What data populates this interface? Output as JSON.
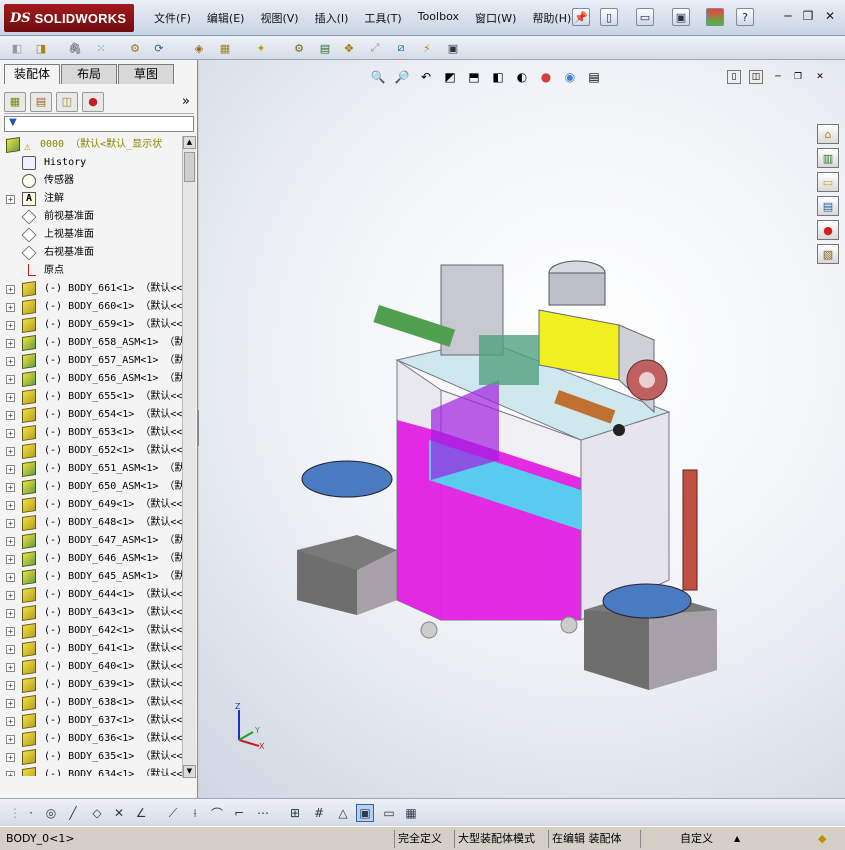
{
  "app": {
    "logo_ds": "DS",
    "logo_text": "SOLIDWORKS"
  },
  "menu": [
    "文件(F)",
    "编辑(E)",
    "视图(V)",
    "插入(I)",
    "工具(T)",
    "Toolbox",
    "窗口(W)",
    "帮助(H)"
  ],
  "left_panel": {
    "tabs": [
      "装配体",
      "布局",
      "草图"
    ],
    "active_tab": 0,
    "expand_label": "»",
    "filter_label": "▼"
  },
  "tree": {
    "root": "0000 （默认<默认_显示状",
    "system_items": [
      {
        "label": "History",
        "icon": "history-icon",
        "type": "hist"
      },
      {
        "label": "传感器",
        "icon": "sensor-icon",
        "type": "sensor"
      },
      {
        "label": "注解",
        "icon": "annotation-icon",
        "type": "note"
      },
      {
        "label": "前视基准面",
        "icon": "plane-icon",
        "type": "plane"
      },
      {
        "label": "上视基准面",
        "icon": "plane-icon",
        "type": "plane"
      },
      {
        "label": "右视基准面",
        "icon": "plane-icon",
        "type": "plane"
      },
      {
        "label": "原点",
        "icon": "origin-icon",
        "type": "origin"
      }
    ],
    "components": [
      {
        "label": "(-) BODY_661<1> （默认<<",
        "type": "part"
      },
      {
        "label": "(-) BODY_660<1> （默认<<",
        "type": "part"
      },
      {
        "label": "(-) BODY_659<1> （默认<<",
        "type": "part"
      },
      {
        "label": "(-) BODY_658_ASM<1> （默",
        "type": "asm"
      },
      {
        "label": "(-) BODY_657_ASM<1> （默",
        "type": "asm"
      },
      {
        "label": "(-) BODY_656_ASM<1> （默",
        "type": "asm"
      },
      {
        "label": "(-) BODY_655<1> （默认<<",
        "type": "part"
      },
      {
        "label": "(-) BODY_654<1> （默认<<",
        "type": "part"
      },
      {
        "label": "(-) BODY_653<1> （默认<<",
        "type": "part"
      },
      {
        "label": "(-) BODY_652<1> （默认<<",
        "type": "part"
      },
      {
        "label": "(-) BODY_651_ASM<1> （默",
        "type": "asm"
      },
      {
        "label": "(-) BODY_650_ASM<1> （默",
        "type": "asm"
      },
      {
        "label": "(-) BODY_649<1> （默认<<",
        "type": "part"
      },
      {
        "label": "(-) BODY_648<1> （默认<<",
        "type": "part"
      },
      {
        "label": "(-) BODY_647_ASM<1> （默",
        "type": "asm"
      },
      {
        "label": "(-) BODY_646_ASM<1> （默",
        "type": "asm"
      },
      {
        "label": "(-) BODY_645_ASM<1> （默",
        "type": "asm"
      },
      {
        "label": "(-) BODY_644<1> （默认<<",
        "type": "part"
      },
      {
        "label": "(-) BODY_643<1> （默认<<",
        "type": "part"
      },
      {
        "label": "(-) BODY_642<1> （默认<<",
        "type": "part"
      },
      {
        "label": "(-) BODY_641<1> （默认<<",
        "type": "part"
      },
      {
        "label": "(-) BODY_640<1> （默认<<",
        "type": "part"
      },
      {
        "label": "(-) BODY_639<1> （默认<<",
        "type": "part"
      },
      {
        "label": "(-) BODY_638<1> （默认<<",
        "type": "part"
      },
      {
        "label": "(-) BODY_637<1> （默认<<",
        "type": "part"
      },
      {
        "label": "(-) BODY_636<1> （默认<<",
        "type": "part"
      },
      {
        "label": "(-) BODY_635<1> （默认<<",
        "type": "part"
      },
      {
        "label": "(-) BODY_634<1> （默认<<",
        "type": "part"
      }
    ]
  },
  "status": {
    "selection": "BODY_0<1>",
    "definition": "完全定义",
    "mode": "大型装配体模式",
    "editing": "在编辑 装配体",
    "units": "自定义",
    "arrow": "▲"
  },
  "colors": {
    "magenta_panel": "#e020e0",
    "cyan_top": "#40e8f0",
    "yellow_top": "#f0f020",
    "turntable": "#4a7ac0",
    "frame": "#e8e8ee"
  },
  "triad": {
    "x": "X",
    "y": "Y",
    "z": "Z"
  }
}
